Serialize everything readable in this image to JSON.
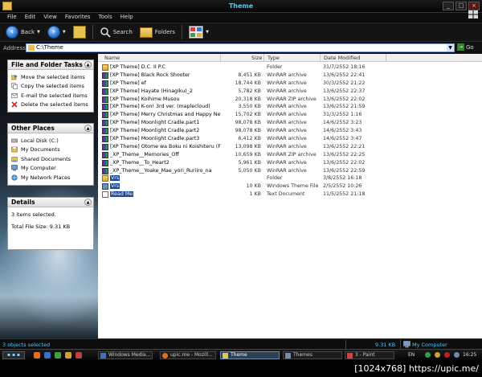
{
  "window": {
    "title": "Theme"
  },
  "menu": [
    "File",
    "Edit",
    "View",
    "Favorites",
    "Tools",
    "Help"
  ],
  "toolbar": {
    "back": "Back",
    "search": "Search",
    "folders": "Folders"
  },
  "address": {
    "label": "Address",
    "value": "C:\\Theme",
    "go": "Go"
  },
  "tasks_panel": {
    "title": "File and Folder Tasks",
    "items": [
      {
        "label": "Move the selected items",
        "icon": "move-icon"
      },
      {
        "label": "Copy the selected items",
        "icon": "copy-icon"
      },
      {
        "label": "E-mail the selected items",
        "icon": "email-icon"
      },
      {
        "label": "Delete the selected items",
        "icon": "delete-icon"
      }
    ]
  },
  "places_panel": {
    "title": "Other Places",
    "items": [
      {
        "label": "Local Disk (C:)",
        "icon": "disk-icon"
      },
      {
        "label": "My Documents",
        "icon": "documents-icon"
      },
      {
        "label": "Shared Documents",
        "icon": "shared-documents-icon"
      },
      {
        "label": "My Computer",
        "icon": "computer-icon"
      },
      {
        "label": "My Network Places",
        "icon": "network-icon"
      }
    ]
  },
  "details_panel": {
    "title": "Details",
    "selected": "3 items selected.",
    "total": "Total File Size: 9.31 KB"
  },
  "columns": {
    "name": "Name",
    "size": "Size",
    "type": "Type",
    "date": "Date Modified"
  },
  "files": [
    {
      "name": "[XP Theme] D.C. II P.C",
      "size": "",
      "type": "Folder",
      "date": "31/7/2552 18:16",
      "icon": "folder",
      "selected": false
    },
    {
      "name": "[XP Theme] Black Rock Shooter",
      "size": "8,451 KB",
      "type": "WinRAR archive",
      "date": "13/6/2552 22:41",
      "icon": "rar",
      "selected": false
    },
    {
      "name": "[XP Theme] ef",
      "size": "18,744 KB",
      "type": "WinRAR archive",
      "date": "30/3/2552 21:22",
      "icon": "rar",
      "selected": false
    },
    {
      "name": "[XP Theme] Hayate (Hinagiku)_2",
      "size": "5,782 KB",
      "type": "WinRAR archive",
      "date": "13/6/2552 22:37",
      "icon": "rar",
      "selected": false
    },
    {
      "name": "[XP Theme] Koihime Musou",
      "size": "20,318 KB",
      "type": "WinRAR ZIP archive",
      "date": "13/6/2552 22:02",
      "icon": "rar",
      "selected": false
    },
    {
      "name": "[XP Theme] K-on! 3rd ver. (maplecloud)",
      "size": "3,550 KB",
      "type": "WinRAR archive",
      "date": "13/6/2552 21:59",
      "icon": "rar",
      "selected": false
    },
    {
      "name": "[XP Theme] Merry Christmas and Happy New ...",
      "size": "15,702 KB",
      "type": "WinRAR archive",
      "date": "31/3/2552 1:16",
      "icon": "rar",
      "selected": false
    },
    {
      "name": "[XP Theme] Moonlight Cradle.part1",
      "size": "98,078 KB",
      "type": "WinRAR archive",
      "date": "14/6/2552 3:23",
      "icon": "rar",
      "selected": false
    },
    {
      "name": "[XP Theme] Moonlight Cradle.part2",
      "size": "98,078 KB",
      "type": "WinRAR archive",
      "date": "14/6/2552 3:43",
      "icon": "rar",
      "selected": false
    },
    {
      "name": "[XP Theme] Moonlight Cradle.part3",
      "size": "6,412 KB",
      "type": "WinRAR archive",
      "date": "14/6/2552 3:47",
      "icon": "rar",
      "selected": false
    },
    {
      "name": "[XP Theme] Otome wa Boku ni Koishiteru (FIX)",
      "size": "13,098 KB",
      "type": "WinRAR archive",
      "date": "13/6/2552 22:21",
      "icon": "rar",
      "selected": false
    },
    {
      "name": "_XP_Theme__Memories_Off",
      "size": "10,659 KB",
      "type": "WinRAR ZIP archive",
      "date": "13/6/2552 22:25",
      "icon": "rar",
      "selected": false
    },
    {
      "name": "_XP_Theme__To_Heart2",
      "size": "5,961 KB",
      "type": "WinRAR archive",
      "date": "13/6/2552 22:02",
      "icon": "rar",
      "selected": false
    },
    {
      "name": "_XP_Theme__Yoake_Mae_yori_Ruriiro_na",
      "size": "5,050 KB",
      "type": "WinRAR archive",
      "date": "13/6/2552 22:59",
      "icon": "rar",
      "selected": false
    },
    {
      "name": "Vrs",
      "size": "",
      "type": "Folder",
      "date": "3/8/2552 16:18",
      "icon": "folder",
      "selected": true
    },
    {
      "name": "Vrs",
      "size": "10 KB",
      "type": "Windows Theme File",
      "date": "2/5/2552 10:26",
      "icon": "theme",
      "selected": true
    },
    {
      "name": "Read Me",
      "size": "1 KB",
      "type": "Text Document",
      "date": "11/5/2552 21:18",
      "icon": "text",
      "selected": true
    }
  ],
  "status": {
    "left": "3 objects selected",
    "size": "9.31 KB",
    "location": "My Computer"
  },
  "taskbar": {
    "tasks": [
      {
        "label": "Windows Media...",
        "active": false
      },
      {
        "label": "upic.me - Mozill...",
        "active": false
      },
      {
        "label": "Theme",
        "active": true
      },
      {
        "label": "Themes",
        "active": false
      },
      {
        "label": "3 - Paint",
        "active": false
      }
    ],
    "lang": "EN",
    "clock": "16:25"
  },
  "watermark": "[1024x768] https://upic.me/"
}
